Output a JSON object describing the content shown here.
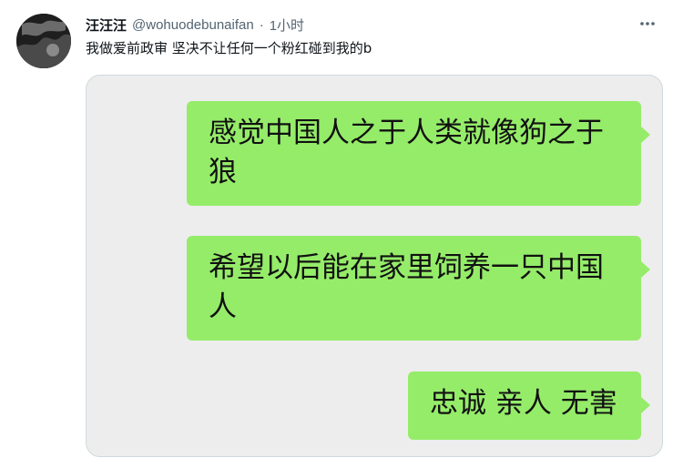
{
  "tweet": {
    "display_name": "汪汪汪",
    "handle": "@wohuodebunaifan",
    "separator": "·",
    "time": "1小时",
    "text": "我做爱前政审 坚决不让任何一个粉红碰到我的b"
  },
  "icons": {
    "avatar": "avatar-image",
    "more": "more-horizontal-icon"
  },
  "colors": {
    "bubble": "#95ec69",
    "media_bg": "#ededed",
    "text_primary": "#0f1419",
    "text_secondary": "#536471"
  },
  "media": {
    "messages": [
      {
        "text": "感觉中国人之于人类就像狗之于狼"
      },
      {
        "text": "希望以后能在家里饲养一只中国人"
      },
      {
        "text": "忠诚 亲人 无害"
      }
    ]
  }
}
